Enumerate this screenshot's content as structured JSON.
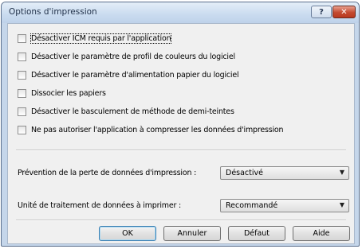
{
  "window": {
    "title": "Options d'impression",
    "help_glyph": "?",
    "close_glyph": "✕"
  },
  "checkboxes": [
    {
      "label": "Désactiver ICM requis par l'application",
      "checked": false
    },
    {
      "label": "Désactiver le paramètre de profil de couleurs du logiciel",
      "checked": false
    },
    {
      "label": "Désactiver le paramètre d'alimentation papier du logiciel",
      "checked": false
    },
    {
      "label": "Dissocier les papiers",
      "checked": false
    },
    {
      "label": "Désactiver le basculement de méthode de demi-teintes",
      "checked": false
    },
    {
      "label": "Ne pas autoriser l'application à compresser les données d'impression",
      "checked": false
    }
  ],
  "settings": {
    "data_loss_label": "Prévention de la perte de données d'impression :",
    "data_loss_value": "Désactivé",
    "unit_label": "Unité de traitement de données à imprimer :",
    "unit_value": "Recommandé"
  },
  "buttons": {
    "ok": "OK",
    "cancel": "Annuler",
    "default": "Défaut",
    "help": "Aide"
  },
  "icons": {
    "dropdown": "chevron-down-icon",
    "help": "help-icon",
    "close": "close-icon"
  },
  "colors": {
    "close_button": "#c44a2f",
    "titlebar": "#c9dbef",
    "client": "#f0f0f0"
  }
}
